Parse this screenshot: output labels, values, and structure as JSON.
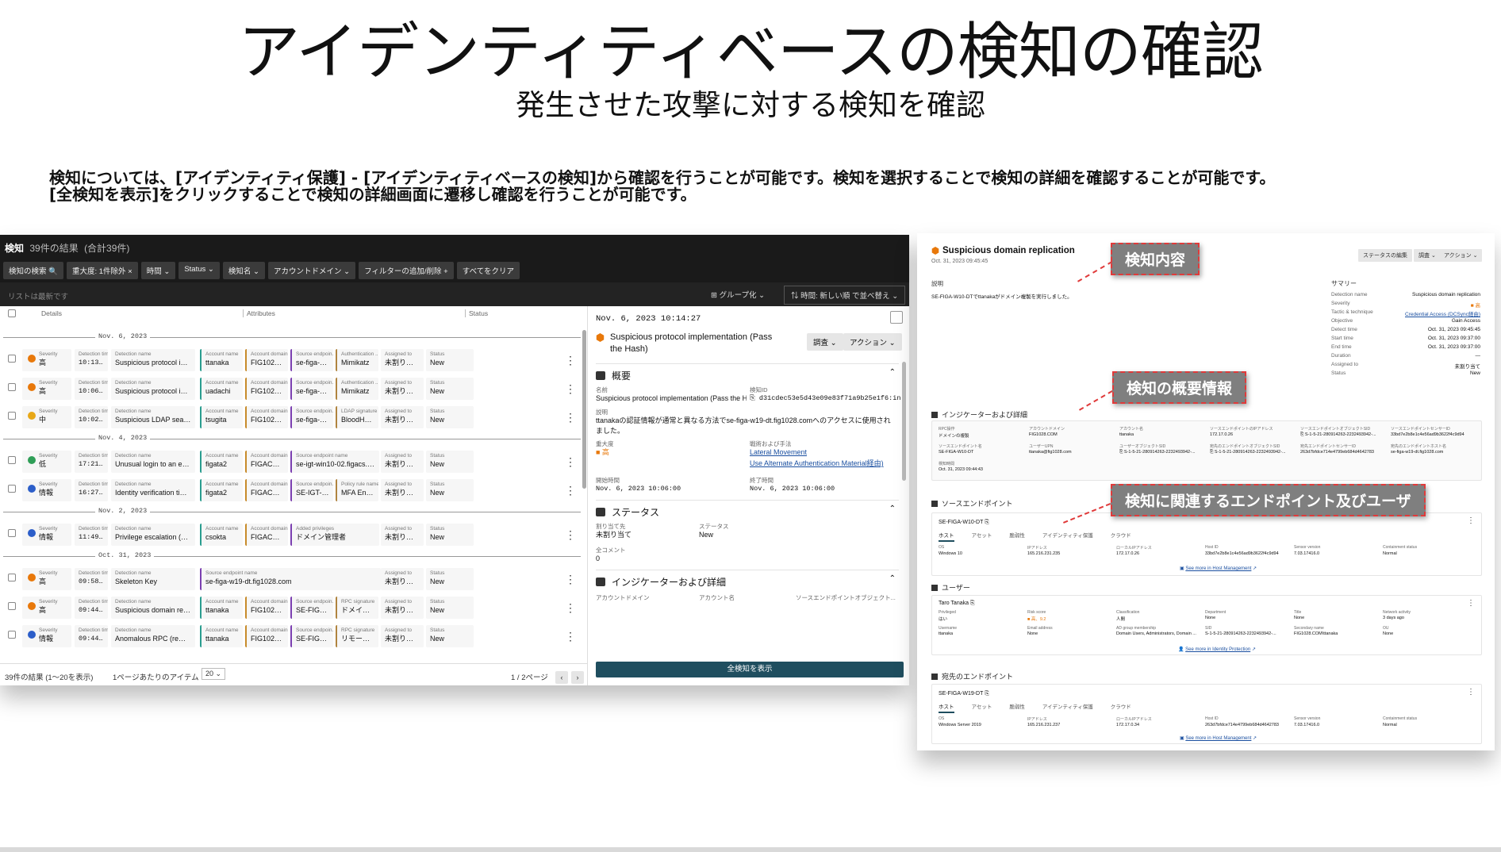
{
  "slide": {
    "title": "アイデンティティベースの検知の確認",
    "subtitle": "発生させた攻撃に対する検知を確認",
    "desc_line1": "検知については、[アイデンティティ保護] - [アイデンティティベースの検知]から確認を行うことが可能です。検知を選択することで検知の詳細を確認することが可能です。",
    "desc_line2": "[全検知を表示]をクリックすることで検知の詳細画面に遷移し確認を行うことが可能です。"
  },
  "list": {
    "header_title": "検知",
    "header_count": "39件の結果",
    "header_total": "(合計39件)",
    "chips": [
      "検知の検索 🔍",
      "重大度: 1件除外 ×",
      "時間 ⌄",
      "Status ⌄",
      "検知名 ⌄",
      "アカウントドメイン ⌄",
      "フィルターの追加/削除 +",
      "すべてをクリア"
    ],
    "refresh_hint": "リストは最新です",
    "group_label": "⊞ グループ化 ⌄",
    "sort_label": "⇅ 時間: 新しい順 で並べ替え ⌄",
    "col_details": "Details",
    "col_attributes": "Attributes",
    "col_status": "Status",
    "groups": [
      {
        "date": "Nov. 6, 2023",
        "rows": [
          {
            "sev": "高",
            "sevcolor": "#e8780a",
            "time": "10:13:26",
            "name": "Suspicious protocol impleme...",
            "acct": "ttanaka",
            "domain": "FIG1028.C...",
            "src": "se-figa-w1...",
            "k5": "Authentication ...",
            "v5": "Mimikatz",
            "assigned": "未割り当て",
            "status": "New"
          },
          {
            "sev": "高",
            "sevcolor": "#e8780a",
            "time": "10:06:26",
            "name": "Suspicious protocol impleme...",
            "acct": "uadachi",
            "domain": "FIG1028.C...",
            "src": "se-figa-w1...",
            "k5": "Authentication ...",
            "v5": "Mimikatz",
            "assigned": "未割り当て",
            "status": "New"
          },
          {
            "sev": "中",
            "sevcolor": "#e8a817",
            "time": "10:02:27",
            "name": "Suspicious LDAP search (acc...",
            "acct": "tsugita",
            "domain": "FIG1028.C...",
            "src": "se-figa-w1...",
            "k5": "LDAP signature",
            "v5": "BloodHoun...",
            "assigned": "未割り当て",
            "status": "New"
          }
        ]
      },
      {
        "date": "Nov. 4, 2023",
        "rows": [
          {
            "sev": "低",
            "sevcolor": "#2f9e57",
            "time": "17:21:30",
            "name": "Unusual login to an endpoint",
            "acct": "figata2",
            "domain": "FIGACS.CO...",
            "src": "se-igt-win10-02.figacs.com",
            "k5": "",
            "v5": "",
            "assigned": "未割り当て",
            "status": "New",
            "wide": true
          },
          {
            "sev": "情報",
            "sevcolor": "#2c5ec9",
            "time": "16:27:19",
            "name": "Identity verification timed out",
            "acct": "figata2",
            "domain": "FIGACS.CO...",
            "src": "SE-IGT-WI...",
            "k5": "Policy rule name",
            "v5": "MFA Enfor...",
            "assigned": "未割り当て",
            "status": "New"
          }
        ]
      },
      {
        "date": "Nov. 2, 2023",
        "rows": [
          {
            "sev": "情報",
            "sevcolor": "#2c5ec9",
            "time": "11:49:41",
            "name": "Privilege escalation (user)",
            "acct": "csokta",
            "domain": "FIGACS.CO...",
            "src": "ドメイン管理者",
            "k4": "Added privileges",
            "assigned": "未割り当て",
            "status": "New",
            "wide": true
          }
        ]
      },
      {
        "date": "Oct. 31, 2023",
        "rows": [
          {
            "sev": "高",
            "sevcolor": "#e8780a",
            "time": "09:58:29",
            "name": "Skeleton Key",
            "acct": "",
            "domain": "",
            "src": "se-figa-w19-dt.fig1028.com",
            "assigned": "未割り当て",
            "status": "New",
            "skel": true
          },
          {
            "sev": "高",
            "sevcolor": "#e8780a",
            "time": "09:44:43",
            "name": "Suspicious domain replication",
            "acct": "ttanaka",
            "domain": "FIG1028.C...",
            "src": "SE-FIGA-W...",
            "k5": "RPC signature",
            "v5": "ドメイン...",
            "assigned": "未割り当て",
            "status": "New"
          },
          {
            "sev": "情報",
            "sevcolor": "#2c5ec9",
            "time": "09:44:37",
            "name": "Anomalous RPC (remote serv...",
            "acct": "ttanaka",
            "domain": "FIG1028.C...",
            "src": "SE-FIGA-W...",
            "k5": "RPC signature",
            "v5": "リモート...",
            "assigned": "未割り当て",
            "status": "New"
          }
        ]
      }
    ],
    "labels": {
      "severity": "Severity",
      "time": "Detection time",
      "name": "Detection name",
      "acct": "Account name",
      "domain": "Account domain",
      "src": "Source endpoin...",
      "src_full": "Source endpoint name",
      "assigned": "Assigned to",
      "status": "Status"
    },
    "footer_count": "39件の結果 (1〜20を表示)",
    "footer_per_page": "1ページあたりのアイテム",
    "footer_page_size": "20 ⌄",
    "footer_page": "1 / 2ページ"
  },
  "detail": {
    "timestamp": "Nov. 6, 2023 10:14:27",
    "title": "Suspicious protocol implementation (Pass the Hash)",
    "btn_investigate": "調査 ⌄",
    "btn_action": "アクション ⌄",
    "sec_overview": "概要",
    "k_name": "名前",
    "v_name": "Suspicious protocol implementation (Pass the H...",
    "k_id": "検知ID",
    "v_id": "⎘ d31cdec53e5d43e09e83f71a9b25e1f6:ind:d3...",
    "k_desc": "説明",
    "v_desc": "ttanakaの認証情報が通常と異なる方法でse-figa-w19-dt.fig1028.comへのアクセスに使用されました。",
    "k_sev": "重大度",
    "v_sev": "■ 高",
    "k_tactic": "戦術および手法",
    "v_tactic1": "Lateral Movement",
    "v_tactic2": "Use Alternate Authentication Material経由)",
    "k_start": "開始時間",
    "v_start": "Nov. 6, 2023 10:06:00",
    "k_end": "終了時間",
    "v_end": "Nov. 6, 2023 10:06:00",
    "sec_status": "ステータス",
    "k_assigned": "割り当て先",
    "v_assigned": "未割り当て",
    "k_status": "ステータス",
    "v_status": "New",
    "k_comments": "全コメント",
    "v_comments": "0",
    "sec_indicators": "インジケーターおよび詳細",
    "k_ind1": "アカウントドメイン",
    "k_ind2": "アカウント名",
    "k_ind3": "ソースエンドポイントオブジェクト...",
    "show_all": "全検知を表示"
  },
  "right": {
    "title": "Suspicious domain replication",
    "date": "Oct. 31, 2023 09:45:45",
    "btn_status": "ステータスの編集",
    "btn_investigate": "調査 ⌄",
    "btn_action": "アクション ⌄",
    "k_desc": "説明",
    "v_desc": "SE-FIGA-W10-DTでttanakaがドメイン複製を実行しました。",
    "summary_title": "サマリー",
    "summary": [
      {
        "k": "Detection name",
        "v": "Suspicious domain replication"
      },
      {
        "k": "Severity",
        "v": "■ 高"
      },
      {
        "k": "Tactic & technique",
        "v": "Credential Access (DCSync経由)"
      },
      {
        "k": "Objective",
        "v": "Gain Access"
      },
      {
        "k": "Detect time",
        "v": "Oct. 31, 2023 09:45:45"
      },
      {
        "k": "Start time",
        "v": "Oct. 31, 2023 09:37:00"
      },
      {
        "k": "End time",
        "v": "Oct. 31, 2023 09:37:00"
      },
      {
        "k": "Duration",
        "v": "—"
      },
      {
        "k": "Assigned to",
        "v": "未割り当て"
      },
      {
        "k": "Status",
        "v": "New"
      }
    ],
    "sec_indicators": "インジケーターおよび詳細",
    "ind": [
      {
        "k": "RPC操作",
        "v": "ドメインの複製"
      },
      {
        "k": "アカウントドメイン",
        "v": "FIG1028.COM"
      },
      {
        "k": "アカウント名",
        "v": "ttanaka"
      },
      {
        "k": "ソースエンドポイントのIPアドレス",
        "v": "172.17.0.26"
      },
      {
        "k": "ソースエンドポイントオブジェクトSID",
        "v": "⎘ S-1-5-21-280914263-2232493942-..."
      },
      {
        "k": "ソースエンドポイントセンサーID",
        "v": "33bd7e2b8e1c4e56ad9b3622f4c9d94"
      },
      {
        "k": "ソースエンドポイント名",
        "v": "SE-FIGA-W10-DT"
      },
      {
        "k": "ユーザーUPN",
        "v": "ttanaka@fig1028.com"
      },
      {
        "k": "ユーザーオブジェクトSID",
        "v": "⎘ S-1-5-21-280914263-2232493942-..."
      },
      {
        "k": "宛先のエンドポイントオブジェクトSID",
        "v": "⎘ S-1-5-21-280914263-2232493942-..."
      },
      {
        "k": "宛先エンドポイントセンサーID",
        "v": "263d7bfdce714e4799eb684d4642783"
      },
      {
        "k": "宛先のエンドポイントホスト名",
        "v": "se-figa-w19-dt.fig1028.com"
      },
      {
        "k": "検知時間",
        "v": "Oct. 31, 2023 09:44:43"
      }
    ],
    "sec_src": "ソースエンドポイント",
    "src_host": "SE-FIGA-W10-DT ⎘",
    "tabs": [
      "ホスト",
      "アセット",
      "脆弱性",
      "アイデンティティ保護",
      "クラウド"
    ],
    "src_row": [
      {
        "k": "OS",
        "v": "Windows 10"
      },
      {
        "k": "IPアドレス",
        "v": "165.216.231.235"
      },
      {
        "k": "ローカルIPアドレス",
        "v": "172.17.0.26"
      },
      {
        "k": "Host ID",
        "v": "33bd7e2b8e1c4e56ad9b3622f4c9d94"
      },
      {
        "k": "Sensor version",
        "v": "7.03.17416.0"
      },
      {
        "k": "Containment status",
        "v": "Normal"
      }
    ],
    "see_more_host": "See more in Host Management",
    "sec_user": "ユーザー",
    "user_name": "Taro Tanaka ⎘",
    "user_row1": [
      {
        "k": "Privileged",
        "v": "はい"
      },
      {
        "k": "Risk score",
        "v": "■ 高、9.2"
      },
      {
        "k": "Classification",
        "v": "人間"
      },
      {
        "k": "Department",
        "v": "None"
      },
      {
        "k": "Title",
        "v": "None"
      },
      {
        "k": "Network activity",
        "v": "3 days ago"
      }
    ],
    "user_row2": [
      {
        "k": "Username",
        "v": "ttanaka"
      },
      {
        "k": "Email address",
        "v": "None"
      },
      {
        "k": "AD group membership",
        "v": "Domain Users, Administrators, Domain ..."
      },
      {
        "k": "SID",
        "v": "S-1-5-21-280914263-2232493942-..."
      },
      {
        "k": "Secondary name",
        "v": "FIG1028.COM\\ttanaka"
      },
      {
        "k": "OU",
        "v": "None"
      }
    ],
    "see_more_identity": "See more in Identity Protection",
    "sec_dst": "宛先のエンドポイント",
    "dst_host": "SE-FIGA-W19-DT ⎘",
    "dst_row": [
      {
        "k": "OS",
        "v": "Windows Server 2019"
      },
      {
        "k": "IPアドレス",
        "v": "165.216.231.237"
      },
      {
        "k": "ローカルIPアドレス",
        "v": "172.17.0.34"
      },
      {
        "k": "Host ID",
        "v": "263d7bfdce714e4799eb684d4642783"
      },
      {
        "k": "Sensor version",
        "v": "7.03.17416.0"
      },
      {
        "k": "Containment status",
        "v": "Normal"
      }
    ]
  },
  "callouts": {
    "c1": "検知内容",
    "c2": "検知の概要情報",
    "c3": "検知に関連するエンドポイント及びユーザ"
  },
  "colors": {
    "high": "#e8780a",
    "medium": "#e8a817",
    "low": "#2f9e57",
    "info": "#2c5ec9",
    "callout_border": "#e03a3a",
    "primary_button": "#1f4e5f"
  }
}
